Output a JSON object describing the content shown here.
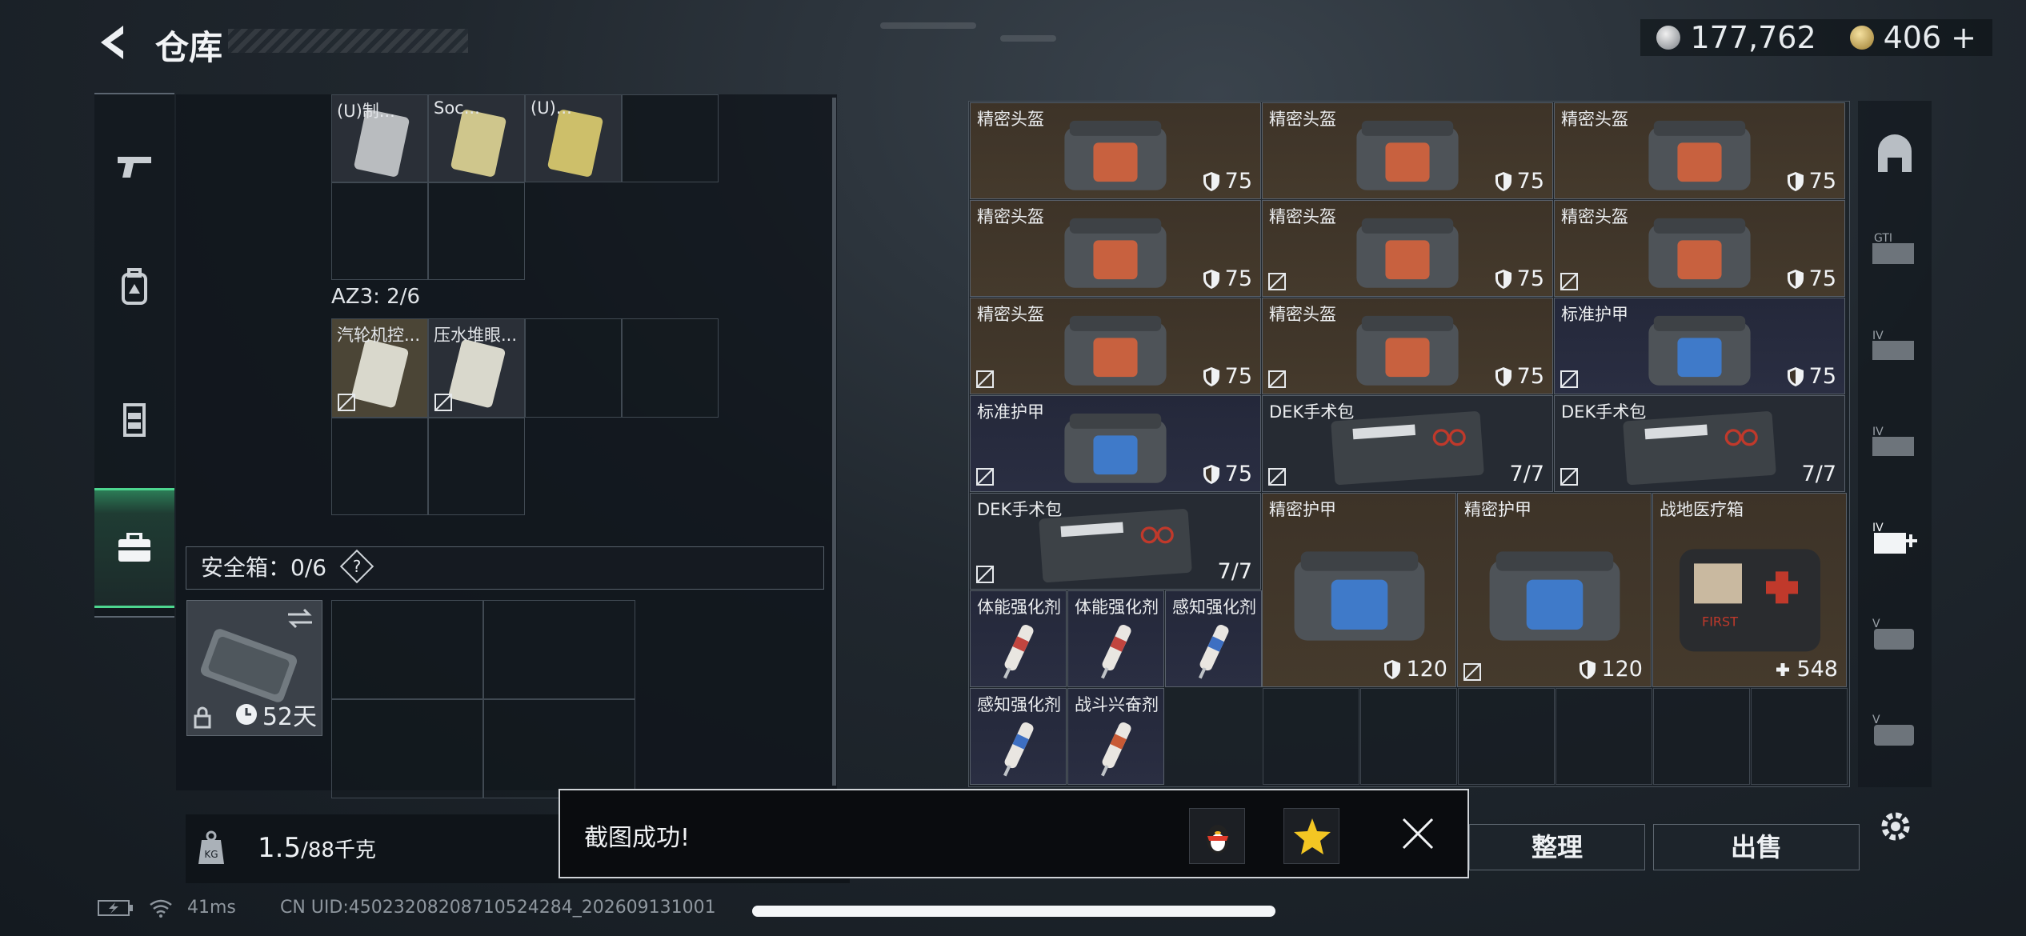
{
  "header": {
    "title": "仓库"
  },
  "currency": {
    "silver": "177,762",
    "gold": "406",
    "plus": "+"
  },
  "left_nav": [
    {
      "name": "weapons",
      "icon": "pistol-icon",
      "active": false
    },
    {
      "name": "gear",
      "icon": "backpack-icon",
      "active": false
    },
    {
      "name": "vest",
      "icon": "vest-icon",
      "active": false
    },
    {
      "name": "case",
      "icon": "briefcase-icon",
      "active": true
    }
  ],
  "left_panel": {
    "top_items": [
      "(U)制...",
      "Soc...",
      "(U)...",
      ""
    ],
    "az3_label": "AZ3: 2/6",
    "az3_items": [
      "汽轮机控...",
      "压水堆眼..."
    ],
    "safebox_label": "安全箱：0/6",
    "safebox_help": "?",
    "case_days": "52天",
    "weight_value": "1.5",
    "weight_unit": "/88千克"
  },
  "inventory": {
    "rows": [
      [
        {
          "name": "精密头盔",
          "val": "75",
          "type": "helmet",
          "bound": false
        },
        {
          "name": "精密头盔",
          "val": "75",
          "type": "helmet",
          "bound": false
        },
        {
          "name": "精密头盔",
          "val": "75",
          "type": "helmet",
          "bound": false
        }
      ],
      [
        {
          "name": "精密头盔",
          "val": "75",
          "type": "helmet",
          "bound": false
        },
        {
          "name": "精密头盔",
          "val": "75",
          "type": "helmet",
          "bound": true
        },
        {
          "name": "精密头盔",
          "val": "75",
          "type": "helmet",
          "bound": true
        }
      ],
      [
        {
          "name": "精密头盔",
          "val": "75",
          "type": "helmet",
          "bound": true
        },
        {
          "name": "精密头盔",
          "val": "75",
          "type": "helmet",
          "bound": true
        },
        {
          "name": "标准护甲",
          "val": "75",
          "type": "armor",
          "bound": true
        }
      ],
      [
        {
          "name": "标准护甲",
          "val": "75",
          "type": "armor",
          "bound": true
        },
        {
          "name": "DEK手术包",
          "val": "7/7",
          "type": "kit",
          "bound": true
        },
        {
          "name": "DEK手术包",
          "val": "7/7",
          "type": "kit",
          "bound": true
        }
      ]
    ],
    "dek_third": {
      "name": "DEK手术包",
      "val": "7/7"
    },
    "large": [
      {
        "name": "精密护甲",
        "val": "120"
      },
      {
        "name": "精密护甲",
        "val": "120"
      },
      {
        "name": "战地医疗箱",
        "val": "548"
      }
    ],
    "injectors": [
      "体能强化剂",
      "体能强化剂",
      "感知强化剂",
      "感知强化剂",
      "战斗兴奋剂"
    ]
  },
  "buttons": {
    "organize": "整理",
    "sell": "出售"
  },
  "toast": {
    "text": "截图成功!"
  },
  "status": {
    "ping": "41ms",
    "uid": "CN UID:4502320820871052428​4_202609131001"
  }
}
